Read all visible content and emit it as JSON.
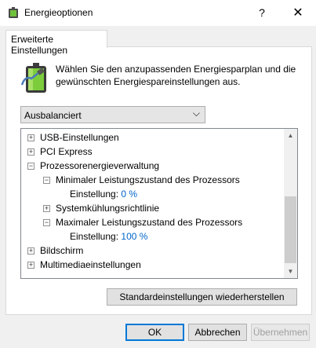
{
  "window": {
    "title": "Energieoptionen",
    "help_label": "?",
    "close_label": "✕"
  },
  "tab": {
    "label": "Erweiterte Einstellungen"
  },
  "description": "Wählen Sie den anzupassenden Energiesparplan und die gewünschten Energiespareinstellungen aus.",
  "plan": {
    "selected": "Ausbalanciert",
    "arrow": "⌵"
  },
  "tree": [
    {
      "label": "USB-Einstellungen",
      "state": "+"
    },
    {
      "label": "PCI Express",
      "state": "+"
    },
    {
      "label": "Prozessorenergieverwaltung",
      "state": "−"
    },
    {
      "label": "Minimaler Leistungszustand des Prozessors",
      "state": "−"
    },
    {
      "label": "Einstellung:",
      "value": "0 %"
    },
    {
      "label": "Systemkühlungsrichtlinie",
      "state": "+"
    },
    {
      "label": "Maximaler Leistungszustand des Prozessors",
      "state": "−"
    },
    {
      "label": "Einstellung:",
      "value": "100 %"
    },
    {
      "label": "Bildschirm",
      "state": "+"
    },
    {
      "label": "Multimediaeinstellungen",
      "state": "+"
    }
  ],
  "scrollbar": {
    "up": "▲",
    "down": "▼"
  },
  "buttons": {
    "restore": "Standardeinstellungen wiederherstellen",
    "ok": "OK",
    "cancel": "Abbrechen",
    "apply": "Übernehmen"
  },
  "colors": {
    "accent": "#0078d7",
    "value": "#0066cc"
  }
}
